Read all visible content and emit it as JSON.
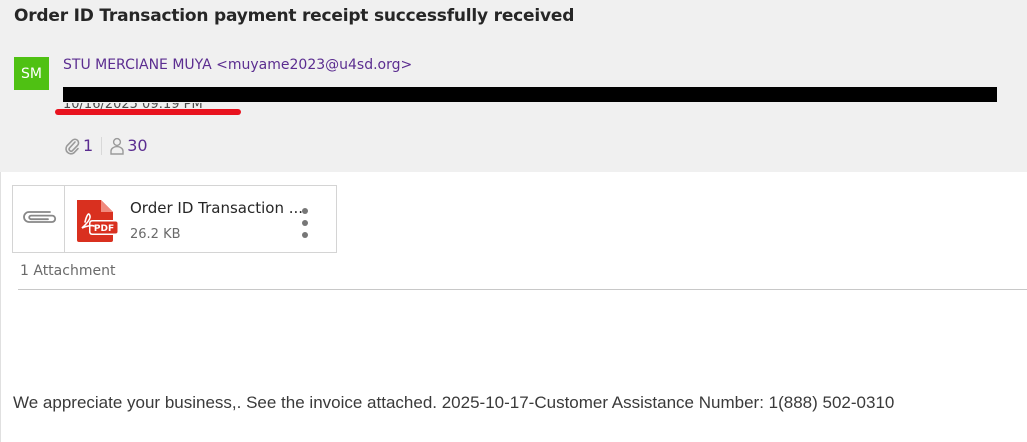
{
  "email": {
    "subject": "Order ID Transaction payment receipt successfully received",
    "sender": {
      "initials": "SM",
      "display": "STU MERCIANE MUYA <muyame2023@u4sd.org>",
      "avatar_color": "#4fc113"
    },
    "recipients_redacted": true,
    "date_partial": "10/16/2025 09:19 PM",
    "attachment_count_badge": "1",
    "recipient_count_badge": "30",
    "body": "We appreciate your business,. See the invoice attached. 2025-10-17-Customer Assistance Number: 1(888) 502-0310"
  },
  "attachment": {
    "file_name": "Order ID Transaction ...",
    "size": "26.2 KB",
    "type_label": "PDF",
    "summary": "1 Attachment"
  },
  "colors": {
    "accent_purple": "#5b2d90",
    "pdf_red": "#d9301f",
    "annotation_red": "#e8131f"
  }
}
